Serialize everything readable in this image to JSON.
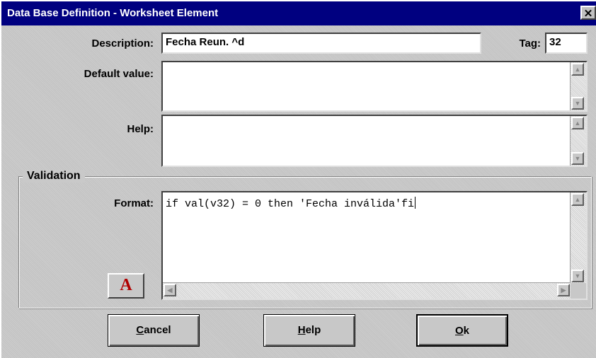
{
  "window": {
    "title": "Data Base Definition - Worksheet Element",
    "close_glyph": "✕"
  },
  "form": {
    "description_label": "Description:",
    "description_value": "Fecha Reun. ^d",
    "tag_label": "Tag:",
    "tag_value": "32",
    "default_value_label": "Default value:",
    "default_value_value": "",
    "help_label": "Help:",
    "help_value": ""
  },
  "validation": {
    "group_title": "Validation",
    "format_label": "Format:",
    "format_value": "if val(v32) = 0 then 'Fecha inválida'fi",
    "font_button_label": "A"
  },
  "buttons": {
    "cancel": {
      "mnemonic": "C",
      "rest": "ancel"
    },
    "help": {
      "mnemonic": "H",
      "rest": "elp"
    },
    "ok": {
      "mnemonic": "O",
      "rest": "k"
    }
  },
  "scroll_glyphs": {
    "up": "▲",
    "down": "▼",
    "left": "◀",
    "right": "▶"
  },
  "colors": {
    "titlebar": "#000080",
    "font_button": "#b00000",
    "face": "#c0c0c0"
  }
}
